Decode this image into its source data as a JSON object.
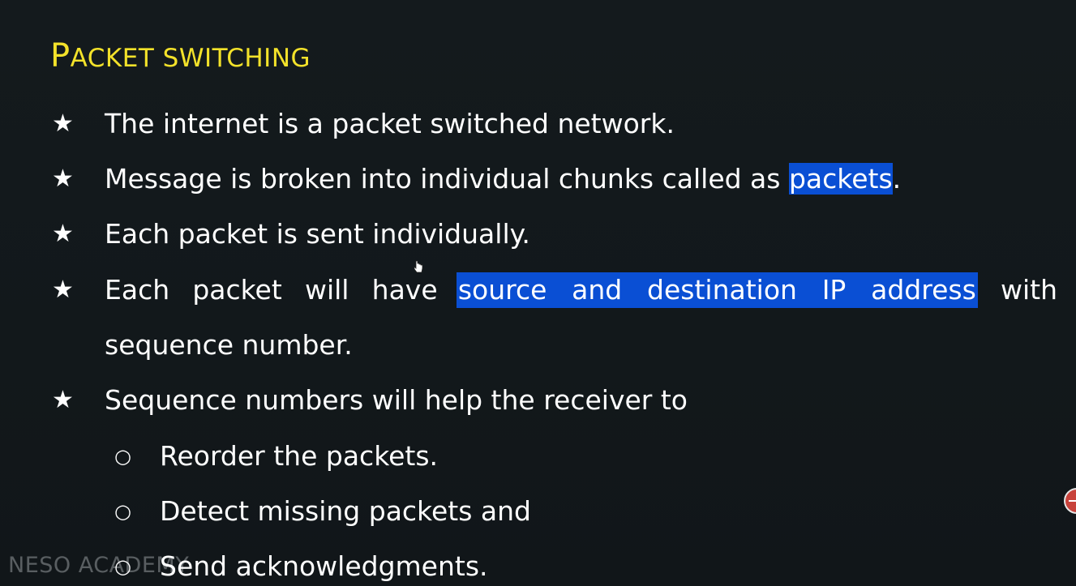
{
  "slide": {
    "title_cap": "P",
    "title_rest": "acket switching",
    "bullets": [
      {
        "text": "The internet is a packet switched network."
      },
      {
        "before": "Message is broken into individual chunks called as ",
        "highlight": "packets",
        "after": "."
      },
      {
        "text": "Each packet is sent individually."
      },
      {
        "words_before": [
          "Each",
          "packet",
          "will",
          "have"
        ],
        "highlight_words": [
          "source",
          "and",
          "destination",
          "IP",
          "address"
        ],
        "words_after": [
          "with"
        ],
        "continuation": "sequence number."
      },
      {
        "text": "Sequence numbers will help the receiver to"
      }
    ],
    "sub_bullets": [
      "Reorder the packets.",
      "Detect missing packets and",
      "Send acknowledgments."
    ],
    "bullet_glyph": "★",
    "sub_bullet_glyph": "○"
  },
  "watermark": "NESO ACADEMY",
  "colors": {
    "background": "#13191c",
    "title": "#f3e22a",
    "text": "#ffffff",
    "highlight": "#0a4fd4"
  }
}
